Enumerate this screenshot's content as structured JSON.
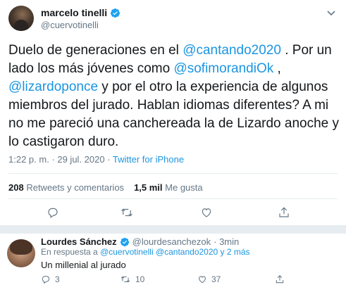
{
  "tweet": {
    "author": {
      "name": "marcelo tinelli",
      "handle": "@cuervotinelli"
    },
    "text_lines": [
      [
        {
          "t": "Duelo de generaciones en el ",
          "link": false
        },
        {
          "t": "@cantando2020",
          "link": true
        },
        {
          "t": " . Por un",
          "link": false
        }
      ],
      [
        {
          "t": "lado los más jóvenes como ",
          "link": false
        },
        {
          "t": "@sofimorandiOk",
          "link": true
        },
        {
          "t": " ,",
          "link": false
        }
      ],
      [
        {
          "t": "@lizardoponce",
          "link": true
        },
        {
          "t": " y por el otro la experiencia de algunos",
          "link": false
        }
      ],
      [
        {
          "t": "miembros del jurado. Hablan idiomas diferentes? A mi",
          "link": false
        }
      ],
      [
        {
          "t": "no me pareció una canchereada la de Lizardo anoche y",
          "link": false
        }
      ],
      [
        {
          "t": "lo castigaron duro.",
          "link": false
        }
      ]
    ],
    "time": "1:22 p. m. · 29 jul. 2020 · ",
    "source": "Twitter for iPhone",
    "stats": {
      "retweets_count": "208",
      "retweets_label": "Retweets y comentarios",
      "likes_count": "1,5 mil",
      "likes_label": "Me gusta"
    }
  },
  "reply": {
    "name": "Lourdes Sánchez",
    "handle": "@lourdesanchezok",
    "time": "· 3min",
    "replying_prefix": "En respuesta a ",
    "replying_to": "@cuervotinelli @cantando2020 y 2 más",
    "text": "Un millenial al jurado",
    "counts": {
      "replies": "3",
      "retweets": "10",
      "likes": "37"
    }
  },
  "colors": {
    "accent": "#1b95e0",
    "verified": "#1da1f2",
    "muted": "#657786",
    "text": "#14171a",
    "divider": "#e6ecf0"
  },
  "icons": [
    "verified-badge-icon",
    "chevron-down-icon",
    "reply-icon",
    "retweet-icon",
    "like-icon",
    "share-icon"
  ]
}
